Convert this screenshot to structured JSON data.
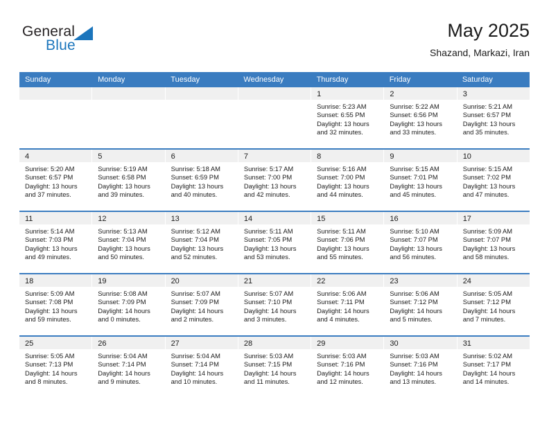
{
  "brand": {
    "name_top": "General",
    "name_bottom": "Blue",
    "accent_color": "#1b75bc"
  },
  "header": {
    "title": "May 2025",
    "subtitle": "Shazand, Markazi, Iran"
  },
  "theme": {
    "header_row_bg": "#3a7cc0",
    "daynum_band_bg": "#f0f0f0",
    "row_divider": "#3a7cc0"
  },
  "weekdays": [
    "Sunday",
    "Monday",
    "Tuesday",
    "Wednesday",
    "Thursday",
    "Friday",
    "Saturday"
  ],
  "weeks": [
    [
      {
        "day": "",
        "sunrise": "",
        "sunset": "",
        "daylight_1": "",
        "daylight_2": ""
      },
      {
        "day": "",
        "sunrise": "",
        "sunset": "",
        "daylight_1": "",
        "daylight_2": ""
      },
      {
        "day": "",
        "sunrise": "",
        "sunset": "",
        "daylight_1": "",
        "daylight_2": ""
      },
      {
        "day": "",
        "sunrise": "",
        "sunset": "",
        "daylight_1": "",
        "daylight_2": ""
      },
      {
        "day": "1",
        "sunrise": "Sunrise: 5:23 AM",
        "sunset": "Sunset: 6:55 PM",
        "daylight_1": "Daylight: 13 hours",
        "daylight_2": "and 32 minutes."
      },
      {
        "day": "2",
        "sunrise": "Sunrise: 5:22 AM",
        "sunset": "Sunset: 6:56 PM",
        "daylight_1": "Daylight: 13 hours",
        "daylight_2": "and 33 minutes."
      },
      {
        "day": "3",
        "sunrise": "Sunrise: 5:21 AM",
        "sunset": "Sunset: 6:57 PM",
        "daylight_1": "Daylight: 13 hours",
        "daylight_2": "and 35 minutes."
      }
    ],
    [
      {
        "day": "4",
        "sunrise": "Sunrise: 5:20 AM",
        "sunset": "Sunset: 6:57 PM",
        "daylight_1": "Daylight: 13 hours",
        "daylight_2": "and 37 minutes."
      },
      {
        "day": "5",
        "sunrise": "Sunrise: 5:19 AM",
        "sunset": "Sunset: 6:58 PM",
        "daylight_1": "Daylight: 13 hours",
        "daylight_2": "and 39 minutes."
      },
      {
        "day": "6",
        "sunrise": "Sunrise: 5:18 AM",
        "sunset": "Sunset: 6:59 PM",
        "daylight_1": "Daylight: 13 hours",
        "daylight_2": "and 40 minutes."
      },
      {
        "day": "7",
        "sunrise": "Sunrise: 5:17 AM",
        "sunset": "Sunset: 7:00 PM",
        "daylight_1": "Daylight: 13 hours",
        "daylight_2": "and 42 minutes."
      },
      {
        "day": "8",
        "sunrise": "Sunrise: 5:16 AM",
        "sunset": "Sunset: 7:00 PM",
        "daylight_1": "Daylight: 13 hours",
        "daylight_2": "and 44 minutes."
      },
      {
        "day": "9",
        "sunrise": "Sunrise: 5:15 AM",
        "sunset": "Sunset: 7:01 PM",
        "daylight_1": "Daylight: 13 hours",
        "daylight_2": "and 45 minutes."
      },
      {
        "day": "10",
        "sunrise": "Sunrise: 5:15 AM",
        "sunset": "Sunset: 7:02 PM",
        "daylight_1": "Daylight: 13 hours",
        "daylight_2": "and 47 minutes."
      }
    ],
    [
      {
        "day": "11",
        "sunrise": "Sunrise: 5:14 AM",
        "sunset": "Sunset: 7:03 PM",
        "daylight_1": "Daylight: 13 hours",
        "daylight_2": "and 49 minutes."
      },
      {
        "day": "12",
        "sunrise": "Sunrise: 5:13 AM",
        "sunset": "Sunset: 7:04 PM",
        "daylight_1": "Daylight: 13 hours",
        "daylight_2": "and 50 minutes."
      },
      {
        "day": "13",
        "sunrise": "Sunrise: 5:12 AM",
        "sunset": "Sunset: 7:04 PM",
        "daylight_1": "Daylight: 13 hours",
        "daylight_2": "and 52 minutes."
      },
      {
        "day": "14",
        "sunrise": "Sunrise: 5:11 AM",
        "sunset": "Sunset: 7:05 PM",
        "daylight_1": "Daylight: 13 hours",
        "daylight_2": "and 53 minutes."
      },
      {
        "day": "15",
        "sunrise": "Sunrise: 5:11 AM",
        "sunset": "Sunset: 7:06 PM",
        "daylight_1": "Daylight: 13 hours",
        "daylight_2": "and 55 minutes."
      },
      {
        "day": "16",
        "sunrise": "Sunrise: 5:10 AM",
        "sunset": "Sunset: 7:07 PM",
        "daylight_1": "Daylight: 13 hours",
        "daylight_2": "and 56 minutes."
      },
      {
        "day": "17",
        "sunrise": "Sunrise: 5:09 AM",
        "sunset": "Sunset: 7:07 PM",
        "daylight_1": "Daylight: 13 hours",
        "daylight_2": "and 58 minutes."
      }
    ],
    [
      {
        "day": "18",
        "sunrise": "Sunrise: 5:09 AM",
        "sunset": "Sunset: 7:08 PM",
        "daylight_1": "Daylight: 13 hours",
        "daylight_2": "and 59 minutes."
      },
      {
        "day": "19",
        "sunrise": "Sunrise: 5:08 AM",
        "sunset": "Sunset: 7:09 PM",
        "daylight_1": "Daylight: 14 hours",
        "daylight_2": "and 0 minutes."
      },
      {
        "day": "20",
        "sunrise": "Sunrise: 5:07 AM",
        "sunset": "Sunset: 7:09 PM",
        "daylight_1": "Daylight: 14 hours",
        "daylight_2": "and 2 minutes."
      },
      {
        "day": "21",
        "sunrise": "Sunrise: 5:07 AM",
        "sunset": "Sunset: 7:10 PM",
        "daylight_1": "Daylight: 14 hours",
        "daylight_2": "and 3 minutes."
      },
      {
        "day": "22",
        "sunrise": "Sunrise: 5:06 AM",
        "sunset": "Sunset: 7:11 PM",
        "daylight_1": "Daylight: 14 hours",
        "daylight_2": "and 4 minutes."
      },
      {
        "day": "23",
        "sunrise": "Sunrise: 5:06 AM",
        "sunset": "Sunset: 7:12 PM",
        "daylight_1": "Daylight: 14 hours",
        "daylight_2": "and 5 minutes."
      },
      {
        "day": "24",
        "sunrise": "Sunrise: 5:05 AM",
        "sunset": "Sunset: 7:12 PM",
        "daylight_1": "Daylight: 14 hours",
        "daylight_2": "and 7 minutes."
      }
    ],
    [
      {
        "day": "25",
        "sunrise": "Sunrise: 5:05 AM",
        "sunset": "Sunset: 7:13 PM",
        "daylight_1": "Daylight: 14 hours",
        "daylight_2": "and 8 minutes."
      },
      {
        "day": "26",
        "sunrise": "Sunrise: 5:04 AM",
        "sunset": "Sunset: 7:14 PM",
        "daylight_1": "Daylight: 14 hours",
        "daylight_2": "and 9 minutes."
      },
      {
        "day": "27",
        "sunrise": "Sunrise: 5:04 AM",
        "sunset": "Sunset: 7:14 PM",
        "daylight_1": "Daylight: 14 hours",
        "daylight_2": "and 10 minutes."
      },
      {
        "day": "28",
        "sunrise": "Sunrise: 5:03 AM",
        "sunset": "Sunset: 7:15 PM",
        "daylight_1": "Daylight: 14 hours",
        "daylight_2": "and 11 minutes."
      },
      {
        "day": "29",
        "sunrise": "Sunrise: 5:03 AM",
        "sunset": "Sunset: 7:16 PM",
        "daylight_1": "Daylight: 14 hours",
        "daylight_2": "and 12 minutes."
      },
      {
        "day": "30",
        "sunrise": "Sunrise: 5:03 AM",
        "sunset": "Sunset: 7:16 PM",
        "daylight_1": "Daylight: 14 hours",
        "daylight_2": "and 13 minutes."
      },
      {
        "day": "31",
        "sunrise": "Sunrise: 5:02 AM",
        "sunset": "Sunset: 7:17 PM",
        "daylight_1": "Daylight: 14 hours",
        "daylight_2": "and 14 minutes."
      }
    ]
  ]
}
